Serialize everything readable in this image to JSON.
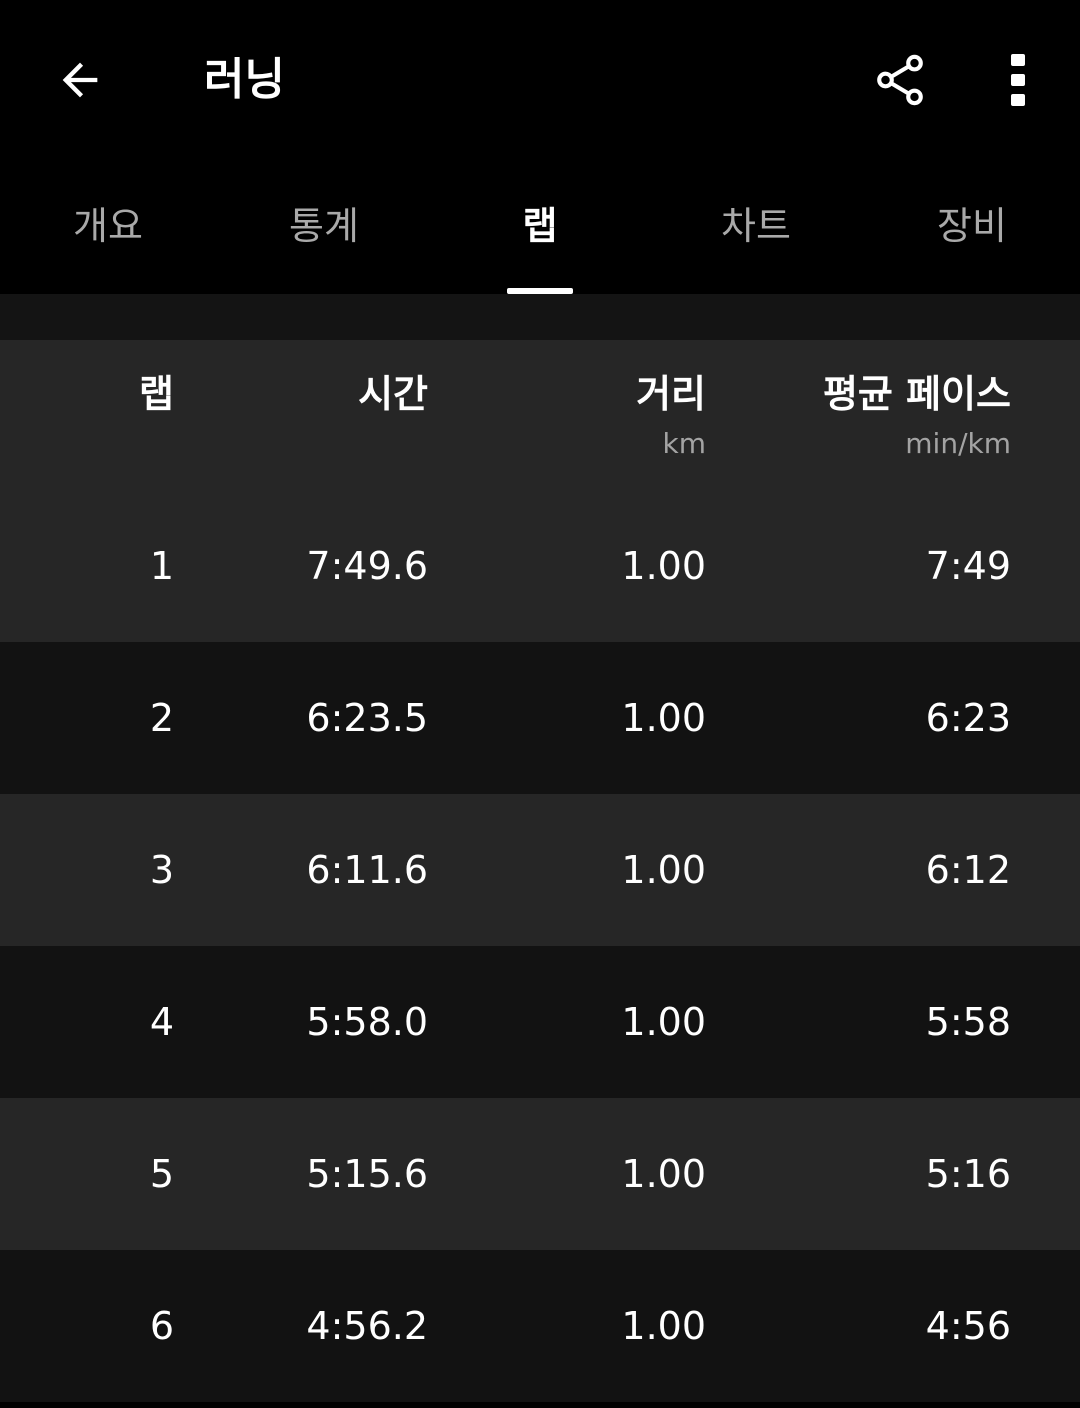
{
  "appbar": {
    "title": "러닝",
    "back_icon": "arrow-left-icon",
    "share_icon": "share-icon",
    "more_icon": "more-vert-icon"
  },
  "tabs": [
    {
      "label": "개요",
      "active": false
    },
    {
      "label": "통계",
      "active": false
    },
    {
      "label": "랩",
      "active": true
    },
    {
      "label": "차트",
      "active": false
    },
    {
      "label": "장비",
      "active": false
    }
  ],
  "table": {
    "headers": [
      {
        "label": "랩",
        "unit": ""
      },
      {
        "label": "시간",
        "unit": ""
      },
      {
        "label": "거리",
        "unit": "km"
      },
      {
        "label": "평균 페이스",
        "unit": "min/km"
      }
    ],
    "rows": [
      {
        "lap": "1",
        "time": "7:49.6",
        "distance": "1.00",
        "pace": "7:49"
      },
      {
        "lap": "2",
        "time": "6:23.5",
        "distance": "1.00",
        "pace": "6:23"
      },
      {
        "lap": "3",
        "time": "6:11.6",
        "distance": "1.00",
        "pace": "6:12"
      },
      {
        "lap": "4",
        "time": "5:58.0",
        "distance": "1.00",
        "pace": "5:58"
      },
      {
        "lap": "5",
        "time": "5:15.6",
        "distance": "1.00",
        "pace": "5:16"
      },
      {
        "lap": "6",
        "time": "4:56.2",
        "distance": "1.00",
        "pace": "4:56"
      }
    ]
  },
  "colors": {
    "background": "#000000",
    "row_odd": "#262626",
    "row_even": "#121212",
    "tab_inactive": "#a9a9a9",
    "text": "#ffffff"
  }
}
